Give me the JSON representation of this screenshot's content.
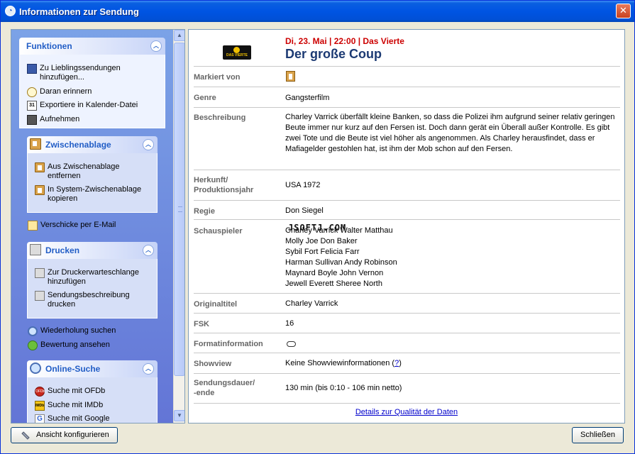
{
  "window": {
    "title": "Informationen zur Sendung",
    "close_label": "✕"
  },
  "taskpane": {
    "funktionen": {
      "title": "Funktionen",
      "items": [
        {
          "label": "Zu Lieblingssendungen hinzufügen...",
          "icon": "favorites-icon"
        },
        {
          "label": "Daran erinnern",
          "icon": "reminder-clock-icon"
        },
        {
          "label": "Exportiere in Kalender-Datei",
          "icon": "calendar-icon"
        },
        {
          "label": "Aufnehmen",
          "icon": "record-icon"
        }
      ]
    },
    "zwischenablage": {
      "title": "Zwischenablage",
      "items": [
        {
          "label": "Aus Zwischenablage entfernen",
          "icon": "clipboard-icon"
        },
        {
          "label": "In System-Zwischenablage kopieren",
          "icon": "clipboard-icon"
        }
      ]
    },
    "email": {
      "label": "Verschicke per E-Mail",
      "icon": "mail-icon"
    },
    "drucken": {
      "title": "Drucken",
      "items": [
        {
          "label": "Zur Druckerwarteschlange hinzufügen",
          "icon": "printer-icon"
        },
        {
          "label": "Sendungsbeschreibung drucken",
          "icon": "printer-icon"
        }
      ]
    },
    "extra": [
      {
        "label": "Wiederholung suchen",
        "icon": "search-icon"
      },
      {
        "label": "Bewertung ansehen",
        "icon": "rating-icon"
      }
    ],
    "online": {
      "title": "Online-Suche",
      "items": [
        {
          "label": "Suche mit OFDb",
          "icon": "ofdb-icon",
          "badge": "OFDb"
        },
        {
          "label": "Suche mit IMDb",
          "icon": "imdb-icon",
          "badge": "IMDb"
        },
        {
          "label": "Suche mit Google",
          "icon": "google-icon",
          "badge": "G"
        }
      ]
    }
  },
  "program": {
    "channel_logo_text": "DAS VIERTE",
    "airdate": "Di, 23. Mai | 22:00 | Das Vierte",
    "title": "Der große Coup",
    "rows": {
      "markiert_von": {
        "label": "Markiert von"
      },
      "genre": {
        "label": "Genre",
        "value": "Gangsterfilm"
      },
      "beschreibung": {
        "label": "Beschreibung",
        "value": "Charley Varrick überfällt kleine Banken, so dass die Polizei ihm aufgrund seiner relativ geringen Beute immer nur kurz auf den Fersen ist. Doch dann gerät ein Überall außer Kontrolle. Es gibt zwei Tote und die Beute ist viel höher als angenommen. Als Charley herausfindet, dass er Mafiagelder gestohlen hat, ist ihm der Mob schon auf den Fersen."
      },
      "herkunft": {
        "label1": "Herkunft/",
        "label2": "Produktionsjahr",
        "value": "USA 1972"
      },
      "regie": {
        "label": "Regie",
        "value": "Don Siegel"
      },
      "schauspieler": {
        "label": "Schauspieler",
        "values": [
          "Charley Varrick Walter Matthau",
          "Molly Joe Don Baker",
          "Sybil Fort Felicia Farr",
          "Harman Sullivan Andy Robinson",
          "Maynard Boyle John Vernon",
          "Jewell Everett Sheree North"
        ]
      },
      "originaltitel": {
        "label": "Originaltitel",
        "value": "Charley Varrick"
      },
      "fsk": {
        "label": "FSK",
        "value": "16"
      },
      "format": {
        "label": "Formatinformation"
      },
      "showview": {
        "label": "Showview",
        "value": "Keine Showviewinformationen",
        "help": "?"
      },
      "dauer": {
        "label1": "Sendungsdauer/",
        "label2": "-ende",
        "value": "130 min (bis 0:10 - 106 min netto)"
      }
    },
    "details_link": "Details zur Qualität der Daten",
    "watermark": "JSOFTJ.COM"
  },
  "buttons": {
    "configure": "Ansicht konfigurieren",
    "close": "Schließen"
  }
}
